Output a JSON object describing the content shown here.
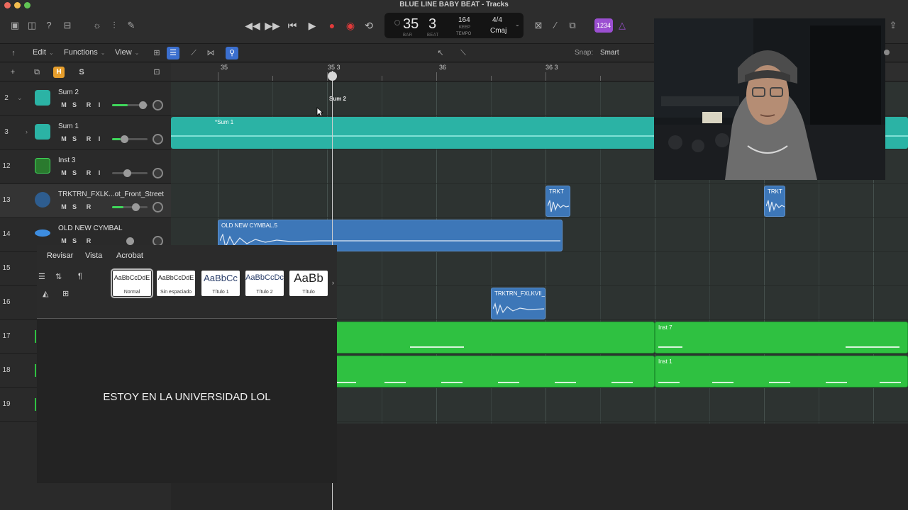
{
  "window": {
    "title": "BLUE LINE BABY BEAT - Tracks"
  },
  "lcd": {
    "bar": "35",
    "beat": "3",
    "bar_label": "BAR",
    "beat_label": "BEAT",
    "tempo": "164",
    "tempo_mode": "KEEP",
    "tempo_label": "TEMPO",
    "time_signature": "4/4",
    "key": "Cmaj"
  },
  "badge_count_in": "1234",
  "toolbar": {
    "edit": "Edit",
    "functions": "Functions",
    "view": "View",
    "snap_label": "Snap:",
    "snap_value": "Smart"
  },
  "header": {
    "h_label": "H",
    "s_label": "S"
  },
  "ruler": {
    "labels": [
      "35",
      "35 3",
      "36",
      "36 3"
    ]
  },
  "tracks": [
    {
      "num": "2",
      "name": "Sum 2"
    },
    {
      "num": "3",
      "name": "Sum 1"
    },
    {
      "num": "12",
      "name": "Inst 3"
    },
    {
      "num": "13",
      "name": "TRKTRN_FXLK...ot_Front_Street"
    },
    {
      "num": "14",
      "name": "OLD NEW CYMBAL"
    },
    {
      "num": "15",
      "name": ""
    },
    {
      "num": "16",
      "name": ""
    },
    {
      "num": "17",
      "name": ""
    },
    {
      "num": "18",
      "name": ""
    },
    {
      "num": "19",
      "name": ""
    }
  ],
  "msr": {
    "m": "M",
    "s": "S",
    "r": "R",
    "i": "I"
  },
  "regions": {
    "sum2_label": "Sum 2",
    "sum1": "*Sum 1",
    "trkt_a": "TRKT",
    "trkt_b": "TRKT",
    "cymbal": "OLD NEW CYMBAL.5",
    "trktrn": "TRKTRN_FXLKVII_",
    "inst7": "Inst 7",
    "inst1": "Inst 1"
  },
  "word": {
    "menu": [
      "Revisar",
      "Vista",
      "Acrobat"
    ],
    "styles": [
      {
        "sample": "AaBbCcDdE",
        "name": "Normal"
      },
      {
        "sample": "AaBbCcDdE",
        "name": "Sin espaciado"
      },
      {
        "sample": "AaBbCc",
        "name": "Título 1"
      },
      {
        "sample": "AaBbCcDc",
        "name": "Título 2"
      },
      {
        "sample": "AaBb",
        "name": "Título"
      }
    ],
    "document_text": "ESTOY EN LA UNIVERSIDAD LOL"
  },
  "colors": {
    "region_teal": "#2bb3a5",
    "region_blue": "#3d77b8",
    "region_green": "#2fc141",
    "h_button": "#e69e2c",
    "badge": "#9b4fd1",
    "record": "#e23a3a"
  }
}
